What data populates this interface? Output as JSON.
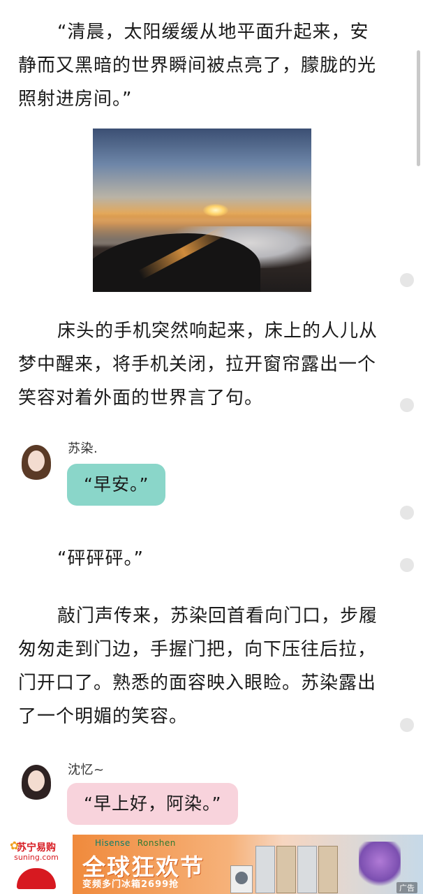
{
  "article": {
    "paragraphs": [
      "“清晨，太阳缓缓从地平面升起来，安静而又黑暗的世界瞬间被点亮了，朦胧的光照射进房间。”",
      "床头的手机突然响起来，床上的人儿从梦中醒来，将手机关闭，拉开窗帘露出一个笑容对着外面的世界言了句。",
      "“砰砰砰。”",
      "敲门声传来，苏染回首看向门口，步履匆匆走到门边，手握门把，向下压往后拉，门开口了。熟悉的面容映入眼睑。苏染露出了一个明媚的笑容。"
    ]
  },
  "chat": [
    {
      "speaker": "苏染.",
      "message": "“早安。”",
      "color": "#8ad6c9"
    },
    {
      "speaker": "沈忆~",
      "message": "“早上好，阿染。”",
      "color": "#f8d3dc"
    }
  ],
  "ad": {
    "brand": "苏宁易购",
    "domain": "suning.com",
    "partner_1": "Hisense",
    "partner_2": "Ronshen",
    "title": "全球狂欢节",
    "subtitle": "变频多门冰箱2699抢",
    "label": "广告"
  }
}
